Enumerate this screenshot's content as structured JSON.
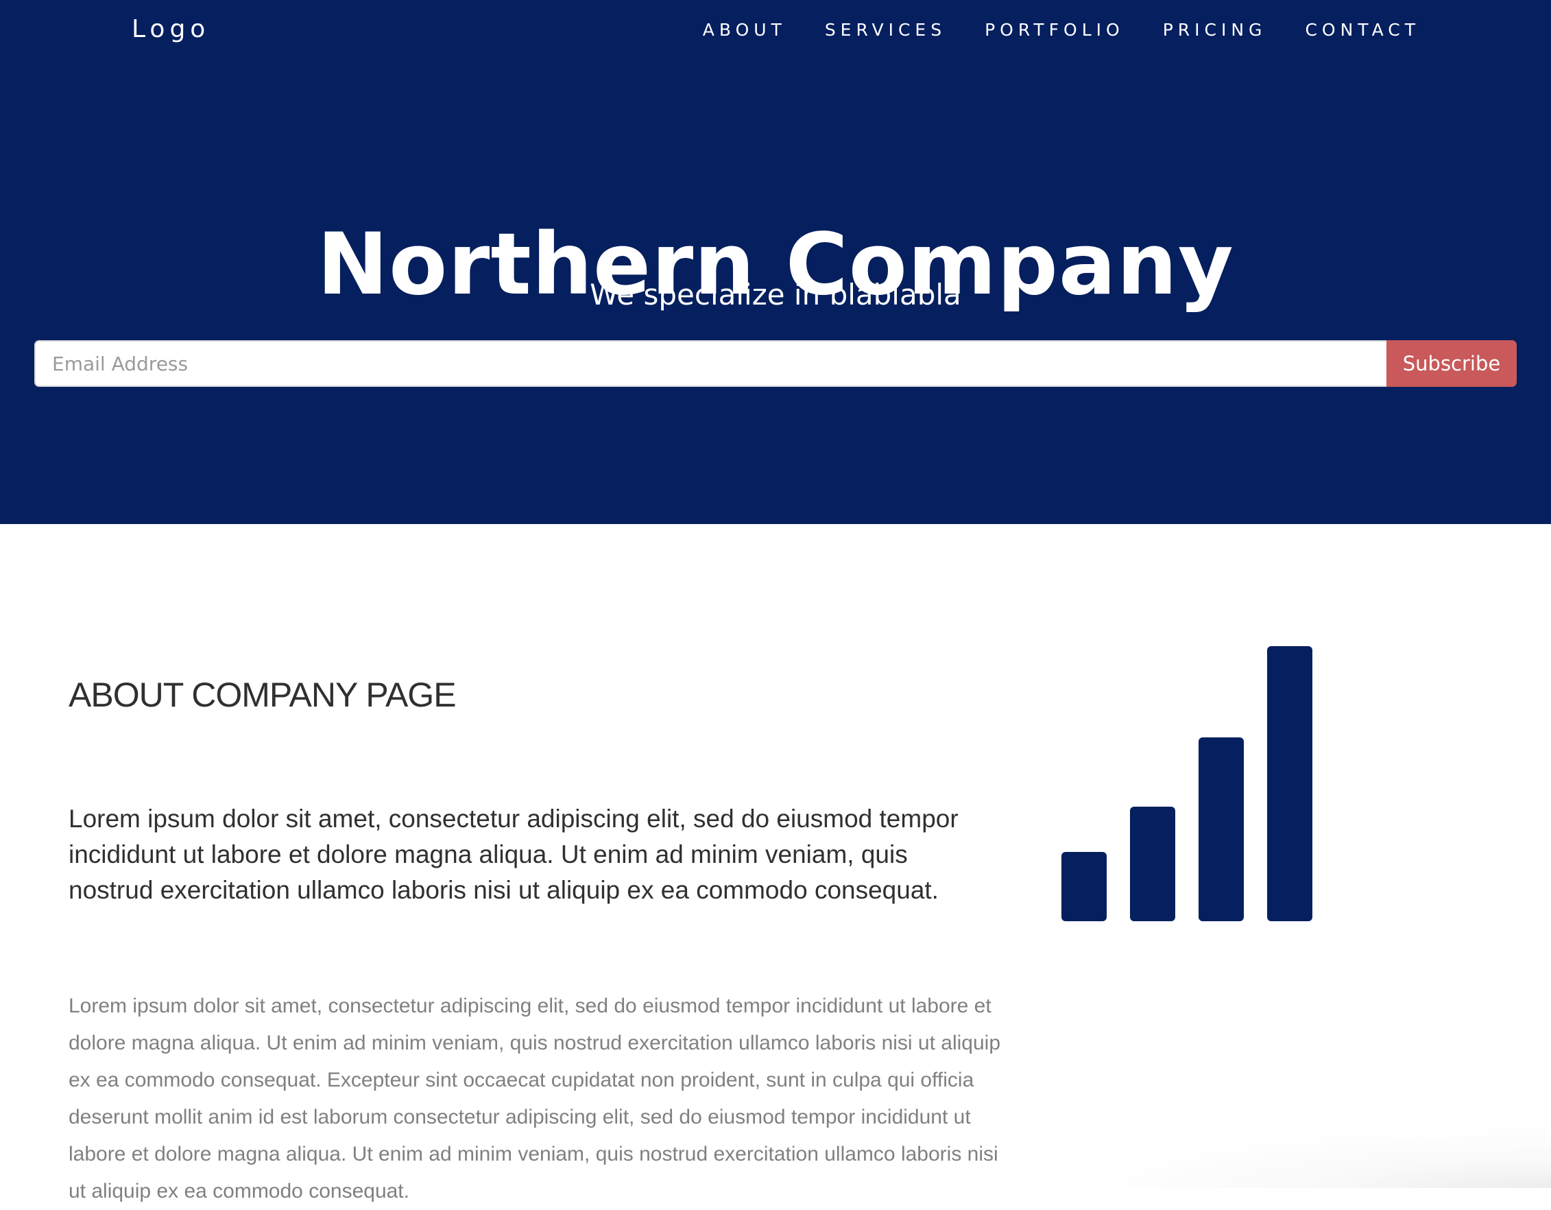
{
  "header": {
    "logo": "Logo",
    "nav": [
      {
        "label": "ABOUT"
      },
      {
        "label": "SERVICES"
      },
      {
        "label": "PORTFOLIO"
      },
      {
        "label": "PRICING"
      },
      {
        "label": "CONTACT"
      }
    ]
  },
  "hero": {
    "title": "Northern Company",
    "subtitle": "We specialize in blablabla",
    "email_placeholder": "Email Address",
    "subscribe_label": "Subscribe"
  },
  "about": {
    "title": "ABOUT COMPANY PAGE",
    "lead": "Lorem ipsum dolor sit amet, consectetur adipiscing elit, sed do eiusmod tempor incididunt ut labore et dolore magna aliqua. Ut enim ad minim veniam, quis nostrud exercitation ullamco laboris nisi ut aliquip ex ea commodo consequat.",
    "body": "Lorem ipsum dolor sit amet, consectetur adipiscing elit, sed do eiusmod tempor incididunt ut labore et dolore magna aliqua. Ut enim ad minim veniam, quis nostrud exercitation ullamco laboris nisi ut aliquip ex ea commodo consequat. Excepteur sint occaecat cupidatat non proident, sunt in culpa qui officia deserunt mollit anim id est laborum consectetur adipiscing elit, sed do eiusmod tempor incididunt ut labore et dolore magna aliqua. Ut enim ad minim veniam, quis nostrud exercitation ullamco laboris nisi ut aliquip ex ea commodo consequat.",
    "icon": "signal-bars-icon"
  },
  "colors": {
    "brand_navy": "#061f5e",
    "accent": "#c9595a",
    "heading_text": "#303030",
    "body_text": "#808080"
  }
}
